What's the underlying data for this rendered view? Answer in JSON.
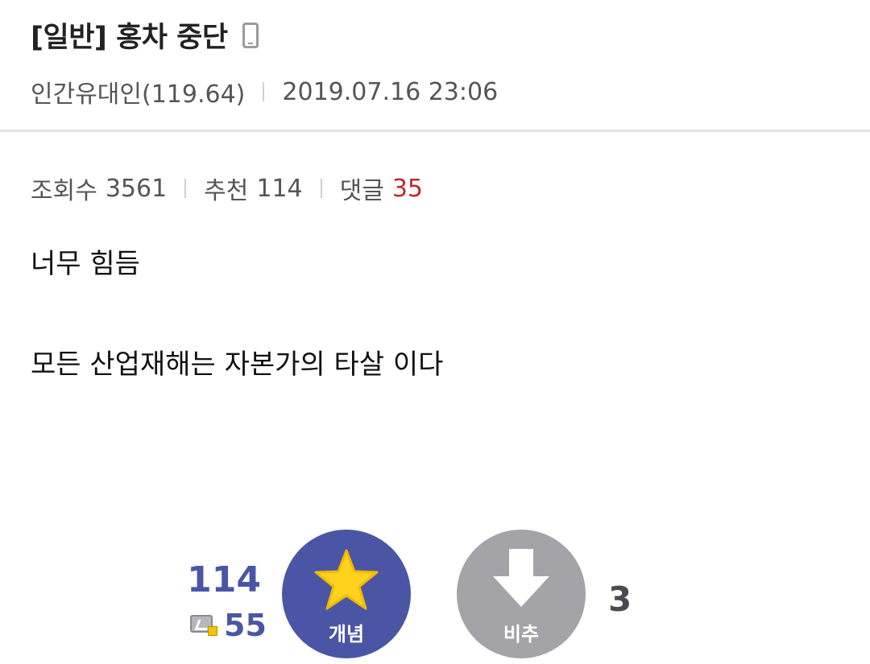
{
  "post": {
    "title": "[일반] 홍차 중단",
    "device_icon": "mobile-phone-icon",
    "author": "인간유대인(119.64)",
    "date": "2019.07.16 23:06",
    "stats": {
      "views_label": "조회수",
      "views": "3561",
      "recommend_label": "추천",
      "recommend": "114",
      "comments_label": "댓글",
      "comments": "35"
    },
    "body_lines": [
      "너무 힘듬",
      "모든 산업재해는 자본가의 타살 이다"
    ]
  },
  "vote": {
    "up_count": "114",
    "fixed_icon": "fixed-user-icon",
    "fixed_count": "55",
    "up_label": "개념",
    "up_icon": "star-icon",
    "down_label": "비추",
    "down_icon": "arrow-down-icon",
    "down_count": "3"
  },
  "colors": {
    "accent": "#4a56a5",
    "comment_count": "#c0292b",
    "down_button": "#a3a3a8"
  }
}
